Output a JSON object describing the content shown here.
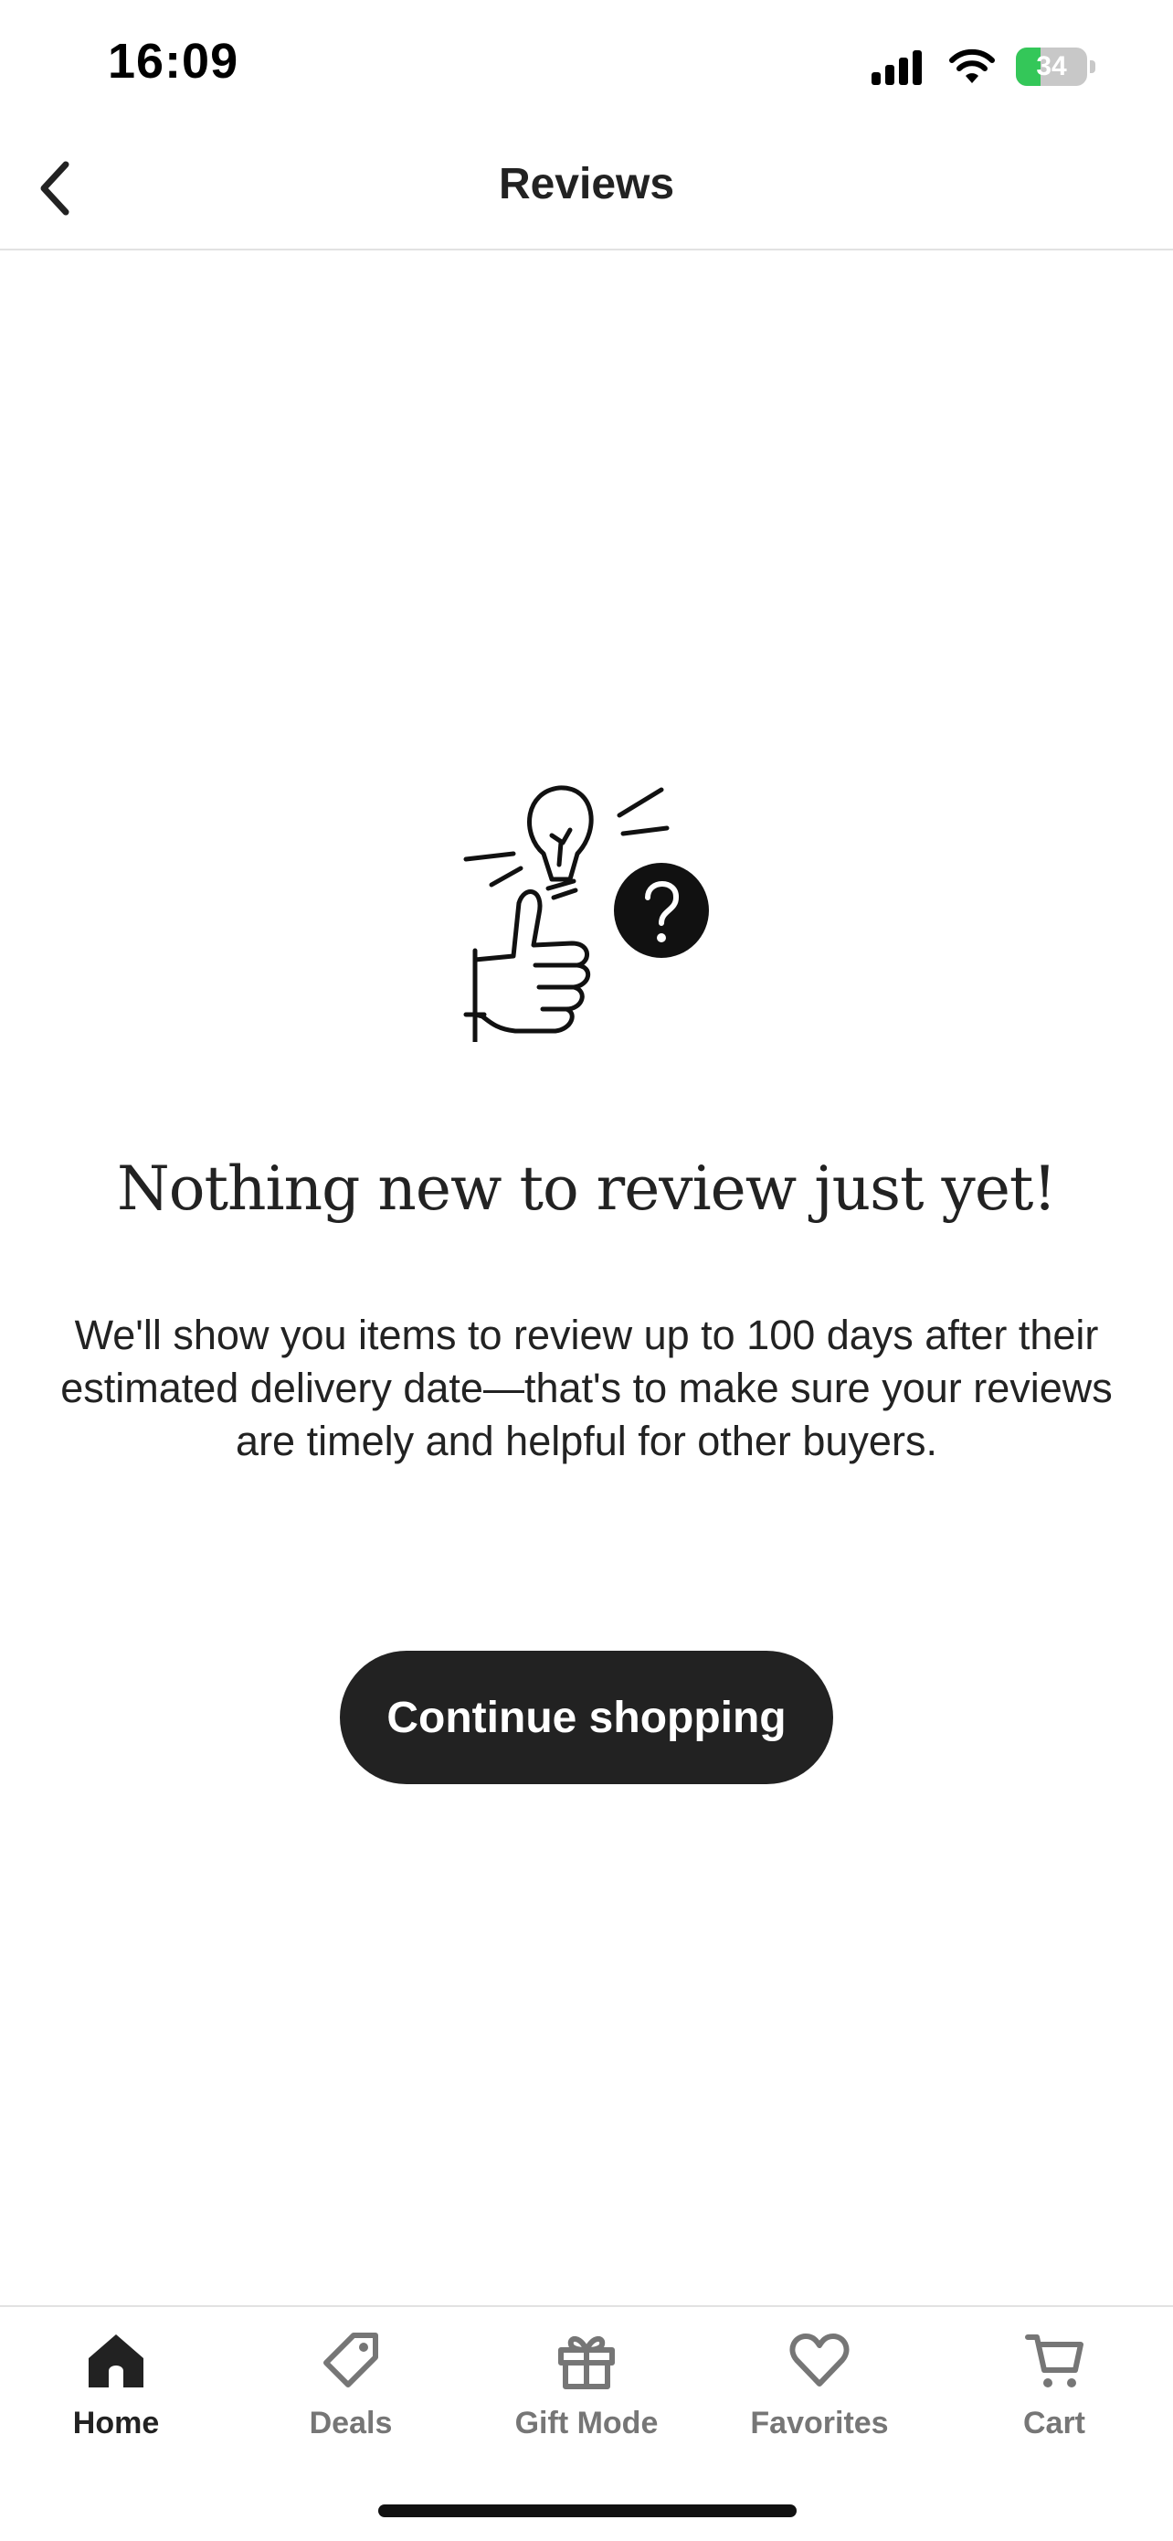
{
  "status_bar": {
    "time": "16:09",
    "battery_level": "34",
    "battery_fraction": 0.34,
    "battery_color": "#34c759"
  },
  "nav": {
    "title": "Reviews",
    "back_icon": "chevron-left-icon"
  },
  "empty_state": {
    "illustration_icon": "thumbs-up-lightbulb-question-icon",
    "heading": "Nothing new to review just yet!",
    "body": "We'll show you items to review up to 100 days after their estimated delivery date—that's to make sure your reviews are timely and helpful for other buyers.",
    "button_label": "Continue shopping"
  },
  "tab_bar": {
    "tabs": [
      {
        "label": "Home",
        "icon": "home-icon",
        "active": true
      },
      {
        "label": "Deals",
        "icon": "tag-icon",
        "active": false
      },
      {
        "label": "Gift Mode",
        "icon": "gift-icon",
        "active": false
      },
      {
        "label": "Favorites",
        "icon": "heart-icon",
        "active": false
      },
      {
        "label": "Cart",
        "icon": "cart-icon",
        "active": false
      }
    ]
  },
  "colors": {
    "primary_button": "#222222",
    "active_tab": "#222222",
    "inactive_tab": "#767676",
    "divider": "#e2e2e2"
  }
}
